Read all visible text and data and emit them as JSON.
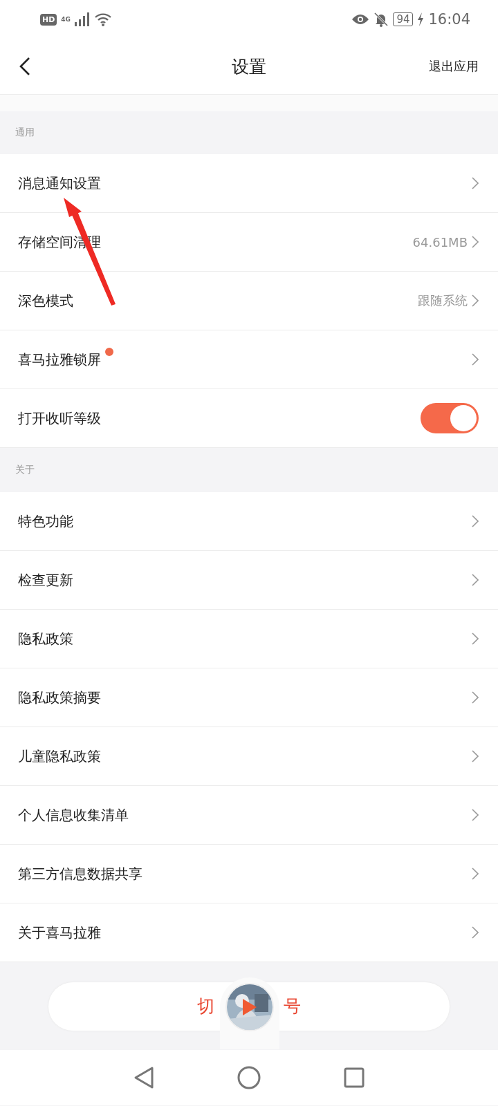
{
  "status_bar": {
    "time": "16:04",
    "battery": "94",
    "network": "4G",
    "hd": "HD"
  },
  "header": {
    "title": "设置",
    "action": "退出应用"
  },
  "sections": [
    {
      "title": "通用",
      "items": [
        {
          "kind": "link",
          "label": "消息通知设置",
          "badge": false
        },
        {
          "kind": "link",
          "label": "存储空间清理",
          "value": "64.61MB",
          "badge": false
        },
        {
          "kind": "link",
          "label": "深色模式",
          "value": "跟随系统",
          "badge": false
        },
        {
          "kind": "link",
          "label": "喜马拉雅锁屏",
          "badge": true
        },
        {
          "kind": "toggle",
          "label": "打开收听等级",
          "on": true
        }
      ]
    },
    {
      "title": "关于",
      "items": [
        {
          "kind": "link",
          "label": "特色功能",
          "badge": false
        },
        {
          "kind": "link",
          "label": "检查更新",
          "badge": false
        },
        {
          "kind": "link",
          "label": "隐私政策",
          "badge": false
        },
        {
          "kind": "link",
          "label": "隐私政策摘要",
          "badge": false
        },
        {
          "kind": "link",
          "label": "儿童隐私政策",
          "badge": false
        },
        {
          "kind": "link",
          "label": "个人信息收集清单",
          "badge": false
        },
        {
          "kind": "link",
          "label": "第三方信息数据共享",
          "badge": false
        },
        {
          "kind": "link",
          "label": "关于喜马拉雅",
          "badge": false
        }
      ]
    }
  ],
  "bottom_button": {
    "label_parts": [
      "切",
      "号"
    ]
  }
}
